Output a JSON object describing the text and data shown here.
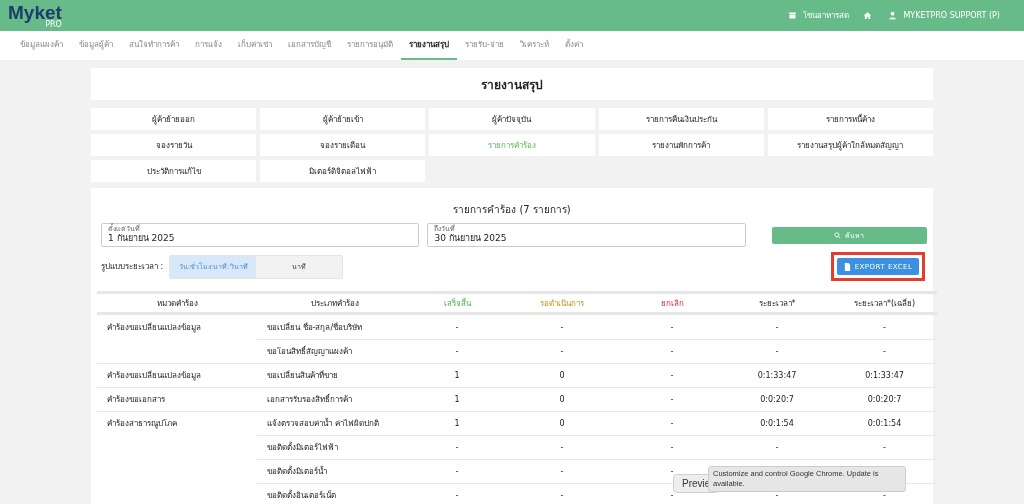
{
  "topbar": {
    "logo": "Myket",
    "logo_sub": "PRO",
    "zone": "โซนอาหารสด",
    "user": "MYKETPRO SUPPORT (P)"
  },
  "nav": [
    {
      "label": "ข้อมูลแผงค้า",
      "selected": false
    },
    {
      "label": "ข้อมูลผู้ค้า",
      "selected": false
    },
    {
      "label": "สนใจทำการค้า",
      "selected": false
    },
    {
      "label": "การแจ้ง",
      "selected": false
    },
    {
      "label": "เก็บค่าเช่า",
      "selected": false
    },
    {
      "label": "เอกสารบัญชี",
      "selected": false
    },
    {
      "label": "รายการอนุมัติ",
      "selected": false
    },
    {
      "label": "รายงานสรุป",
      "selected": true
    },
    {
      "label": "รายรับ-จ่าย",
      "selected": false
    },
    {
      "label": "วิเคราะห์",
      "selected": false
    },
    {
      "label": "ตั้งค่า",
      "selected": false
    }
  ],
  "page_title": "รายงานสรุป",
  "reports": [
    {
      "label": "ผู้ค้าย้ายออก",
      "selected": false
    },
    {
      "label": "ผู้ค้าย้ายเข้า",
      "selected": false
    },
    {
      "label": "ผู้ค้าปัจจุบัน",
      "selected": false
    },
    {
      "label": "รายการคืนเงินประกัน",
      "selected": false
    },
    {
      "label": "รายการหนี้ค้าง",
      "selected": false
    },
    {
      "label": "จองรายวัน",
      "selected": false
    },
    {
      "label": "จองรายเดือน",
      "selected": false
    },
    {
      "label": "รายการคำร้อง",
      "selected": true
    },
    {
      "label": "รายงานพักการค้า",
      "selected": false
    },
    {
      "label": "รายงานสรุปผู้ค้าใกล้หมดสัญญา",
      "selected": false
    },
    {
      "label": "ประวัติการแก้ไข",
      "selected": false
    },
    {
      "label": "มิเตอร์ดิจิตอลไฟฟ้า",
      "selected": false
    }
  ],
  "panel": {
    "title": "รายการคำร้อง (7 รายการ)",
    "from": {
      "label": "ตั้งแต่วันที่",
      "value": "1 กันยายน 2025"
    },
    "to": {
      "label": "ถึงวันที่",
      "value": "30 กันยายน 2025"
    },
    "search_button": "ค้นหา",
    "format_label": "รูปแบบระยะเวลา :",
    "formats": [
      {
        "label": "วัน:ชั่วโมง:นาที:วินาที",
        "selected": true
      },
      {
        "label": "นาที",
        "selected": false
      }
    ],
    "export": {
      "label": "EXPORT EXCEL",
      "highlighted": true
    }
  },
  "table": {
    "columns": [
      {
        "label": "หมวดคำร้อง",
        "kind": "plain"
      },
      {
        "label": "ประเภทคำร้อง",
        "kind": "plain"
      },
      {
        "label": "เสร็จสิ้น",
        "kind": "done"
      },
      {
        "label": "รอดำเนินการ",
        "kind": "pending"
      },
      {
        "label": "ยกเลิก",
        "kind": "cancelled"
      },
      {
        "label": "ระยะเวลา*",
        "kind": "plain"
      },
      {
        "label": "ระยะเวลา*(เฉลี่ย)",
        "kind": "plain"
      }
    ],
    "rows": [
      {
        "cells": [
          "คำร้องขอเปลี่ยนแปลงข้อมูล",
          "ขอเปลี่ยน ชื่อ-สกุล/ชื่อบริษัท",
          "-",
          "-",
          "-",
          "-",
          "-"
        ]
      },
      {
        "cells": [
          "",
          "ขอโอนสิทธิ์สัญญาแผงค้า",
          "-",
          "-",
          "-",
          "-",
          "-"
        ]
      },
      {
        "cells": [
          "คำร้องขอเปลี่ยนแปลงข้อมูล",
          "ขอเปลี่ยนสินค้าที่ขาย",
          "1",
          "0",
          "-",
          "0:1:33:47",
          "0:1:33:47"
        ]
      },
      {
        "cells": [
          "คำร้องขอเอกสาร",
          "เอกสารรับรองสิทธิ์การค้า",
          "1",
          "0",
          "-",
          "0:0:20:7",
          "0:0:20:7"
        ]
      },
      {
        "cells": [
          "คำร้องสาธารณูปโภค",
          "แจ้งตรวจสอบค่าน้ำ ค่าไฟผิดปกติ",
          "1",
          "0",
          "-",
          "0:0:1:54",
          "0:0:1:54"
        ]
      },
      {
        "cells": [
          "",
          "ขอติดตั้งมิเตอร์ไฟฟ้า",
          "-",
          "-",
          "-",
          "-",
          "-"
        ]
      },
      {
        "cells": [
          "",
          "ขอติดตั้งมิเตอร์น้ำ",
          "-",
          "-",
          "-",
          "",
          ""
        ]
      },
      {
        "cells": [
          "",
          "ขอติดตั้งอินเตอร์เน็ต",
          "-",
          "-",
          "-",
          "-",
          "-"
        ]
      }
    ]
  },
  "preview_button": "Previe",
  "tooltip": "Customize and control Google Chrome. Update is available."
}
